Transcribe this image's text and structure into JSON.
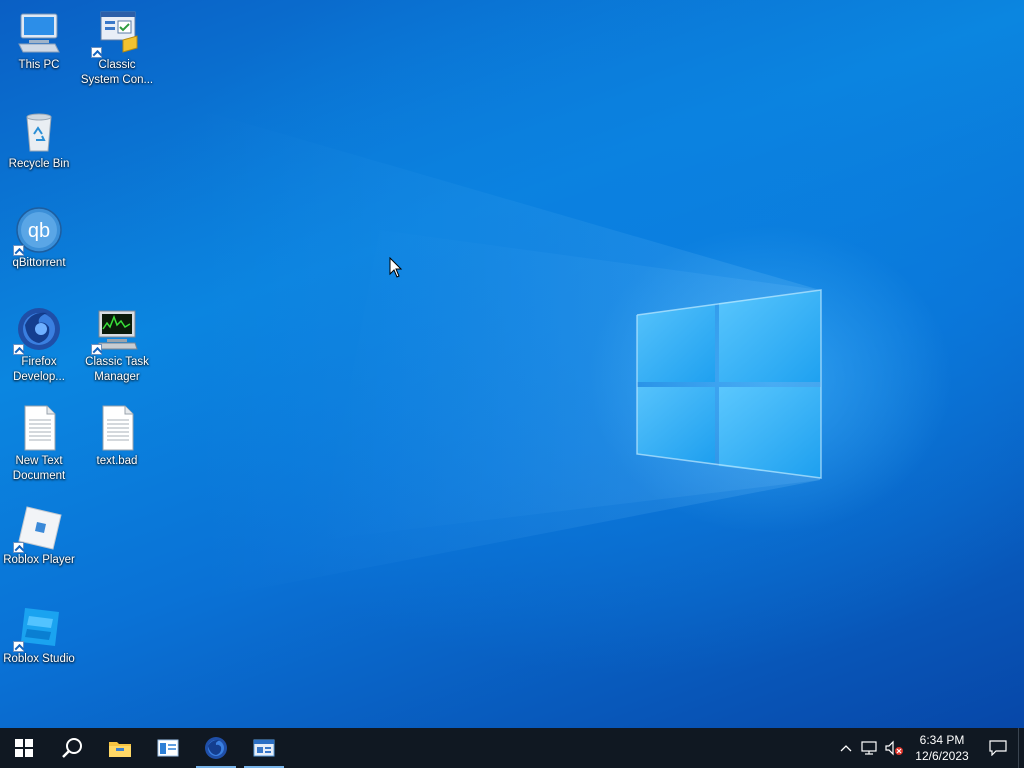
{
  "desktop": {
    "icons": [
      {
        "label": "This PC"
      },
      {
        "label": "Classic System Con..."
      },
      {
        "label": "Recycle Bin"
      },
      {
        "label": "qBittorrent",
        "glyph": "qb"
      },
      {
        "label": "Firefox Develop..."
      },
      {
        "label": "Classic Task Manager"
      },
      {
        "label": "New Text Document"
      },
      {
        "label": "text.bad"
      },
      {
        "label": "Roblox Player"
      },
      {
        "label": "Roblox Studio"
      }
    ]
  },
  "taskbar": {
    "pinned": [
      "start-icon",
      "search-icon",
      "file-explorer-icon",
      "window-app-icon",
      "firefox-developer-icon",
      "control-panel-icon"
    ],
    "clock": {
      "time": "6:34 PM",
      "date": "12/6/2023"
    }
  },
  "colors": {
    "taskbar": "#101822",
    "accent": "#78b4ea"
  }
}
